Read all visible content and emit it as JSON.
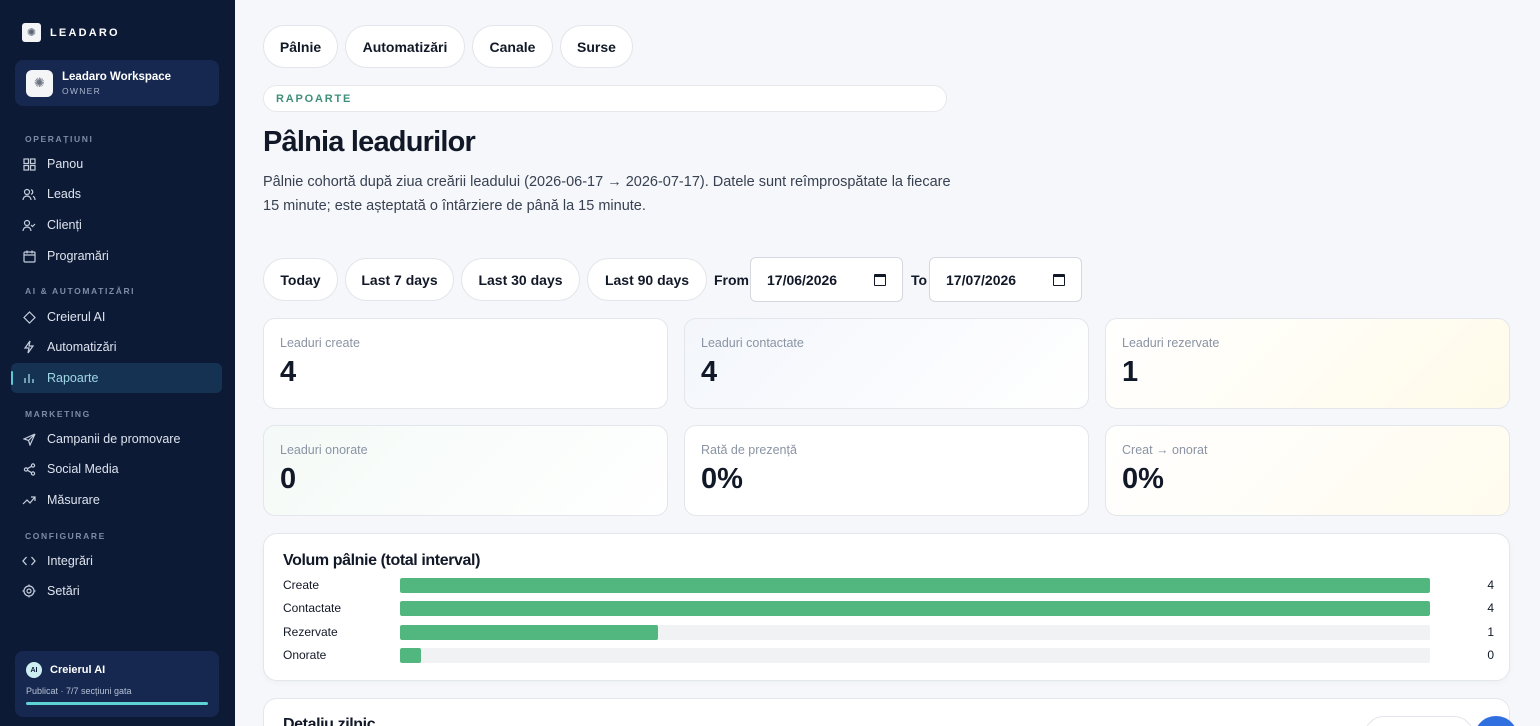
{
  "brand": {
    "name": "LEADARO",
    "logo_icon": "sun-logo-icon"
  },
  "workspace": {
    "name": "Leadaro Workspace",
    "role": "OWNER"
  },
  "sidebar": {
    "sections": [
      {
        "title": "OPERAȚIUNI"
      },
      {
        "title": "AI & AUTOMATIZĂRI"
      },
      {
        "title": "MARKETING"
      },
      {
        "title": "CONFIGURARE"
      }
    ],
    "items": [
      {
        "label": "Panou",
        "icon": "grid-icon"
      },
      {
        "label": "Leads",
        "icon": "users-icon"
      },
      {
        "label": "Clienți",
        "icon": "user-check-icon"
      },
      {
        "label": "Programări",
        "icon": "calendar-icon"
      },
      {
        "label": "Creierul AI",
        "icon": "diamond-icon"
      },
      {
        "label": "Automatizări",
        "icon": "lightning-icon"
      },
      {
        "label": "Rapoarte",
        "icon": "bar-chart-icon",
        "active": true
      },
      {
        "label": "Campanii de promovare",
        "icon": "send-icon"
      },
      {
        "label": "Social Media",
        "icon": "share-icon"
      },
      {
        "label": "Măsurare",
        "icon": "trend-icon"
      },
      {
        "label": "Integrări",
        "icon": "code-icon"
      },
      {
        "label": "Setări",
        "icon": "gear-icon"
      }
    ]
  },
  "ai_card": {
    "badge": "AI",
    "title": "Creierul AI",
    "subtitle": "Publicat · 7/7 secțiuni gata",
    "progress": 1.0
  },
  "top_tabs": [
    "Pâlnie",
    "Automatizări",
    "Canale",
    "Surse"
  ],
  "section_chip": "RAPOARTE",
  "page": {
    "title": "Pâlnia leadurilor",
    "description": "Pâlnie cohortă după ziua creării leadului (2026-06-17 → 2026-07-17). Datele sunt reîmprospătate la fiecare 15 minute; este așteptată o întârziere de până la 15 minute."
  },
  "range_buttons": [
    "Today",
    "Last 7 days",
    "Last 30 days",
    "Last 90 days"
  ],
  "date_range": {
    "from_label": "From",
    "from_value": "17/06/2026",
    "to_label": "To",
    "to_value": "17/07/2026"
  },
  "stats": [
    {
      "label": "Leaduri create",
      "value": "4"
    },
    {
      "label": "Leaduri contactate",
      "value": "4"
    },
    {
      "label": "Leaduri rezervate",
      "value": "1"
    },
    {
      "label": "Leaduri onorate",
      "value": "0"
    },
    {
      "label": "Rată de prezență",
      "value": "0%"
    },
    {
      "label": "Creat → onorat",
      "value": "0%"
    }
  ],
  "funnel": {
    "title": "Volum pâlnie (total interval)",
    "max": 4,
    "rows": [
      {
        "label": "Create",
        "value": 4
      },
      {
        "label": "Contactate",
        "value": 4
      },
      {
        "label": "Rezervate",
        "value": 1
      },
      {
        "label": "Onorate",
        "value": 0
      }
    ]
  },
  "daily_panel": {
    "title": "Detaliu zilnic"
  },
  "colors": {
    "sidebar_bg": "#0d1a35",
    "accent": "#52b77f",
    "active_nav": "#9fd8e6",
    "chip_text": "#3f8f7a"
  }
}
